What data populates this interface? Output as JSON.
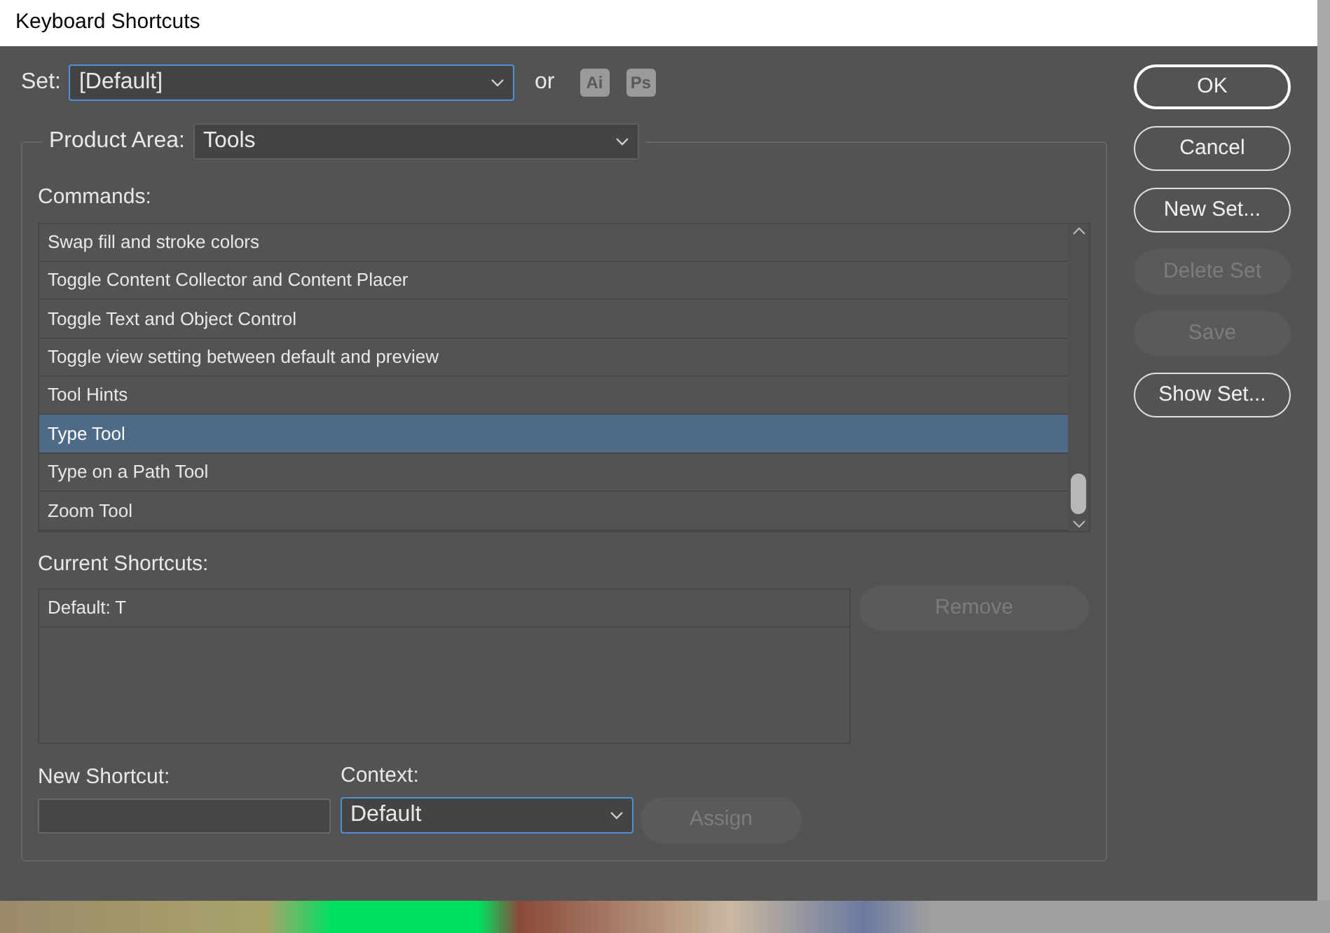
{
  "window": {
    "title": "Keyboard Shortcuts"
  },
  "set": {
    "label": "Set:",
    "value": "[Default]",
    "or": "or",
    "apps": [
      "Ai",
      "Ps"
    ]
  },
  "product_area": {
    "label": "Product Area:",
    "value": "Tools"
  },
  "commands": {
    "label": "Commands:",
    "items": [
      {
        "label": "Swap fill and stroke colors",
        "selected": false
      },
      {
        "label": "Toggle Content Collector and Content Placer",
        "selected": false
      },
      {
        "label": "Toggle Text and Object Control",
        "selected": false
      },
      {
        "label": "Toggle view setting between default and preview",
        "selected": false
      },
      {
        "label": "Tool Hints",
        "selected": false
      },
      {
        "label": "Type Tool",
        "selected": true
      },
      {
        "label": "Type on a Path Tool",
        "selected": false
      },
      {
        "label": "Zoom Tool",
        "selected": false
      }
    ]
  },
  "current_shortcuts": {
    "label": "Current Shortcuts:",
    "items": [
      "Default: T"
    ],
    "remove": {
      "label": "Remove",
      "disabled": true
    }
  },
  "new_shortcut": {
    "label": "New Shortcut:"
  },
  "context": {
    "label": "Context:",
    "value": "Default"
  },
  "assign": {
    "label": "Assign",
    "disabled": true
  },
  "buttons": [
    {
      "label": "OK",
      "disabled": false,
      "default": true
    },
    {
      "label": "Cancel",
      "disabled": false,
      "default": false
    },
    {
      "label": "New Set...",
      "disabled": false,
      "default": false
    },
    {
      "label": "Delete Set",
      "disabled": true,
      "default": false
    },
    {
      "label": "Save",
      "disabled": true,
      "default": false
    },
    {
      "label": "Show Set...",
      "disabled": false,
      "default": false
    }
  ]
}
